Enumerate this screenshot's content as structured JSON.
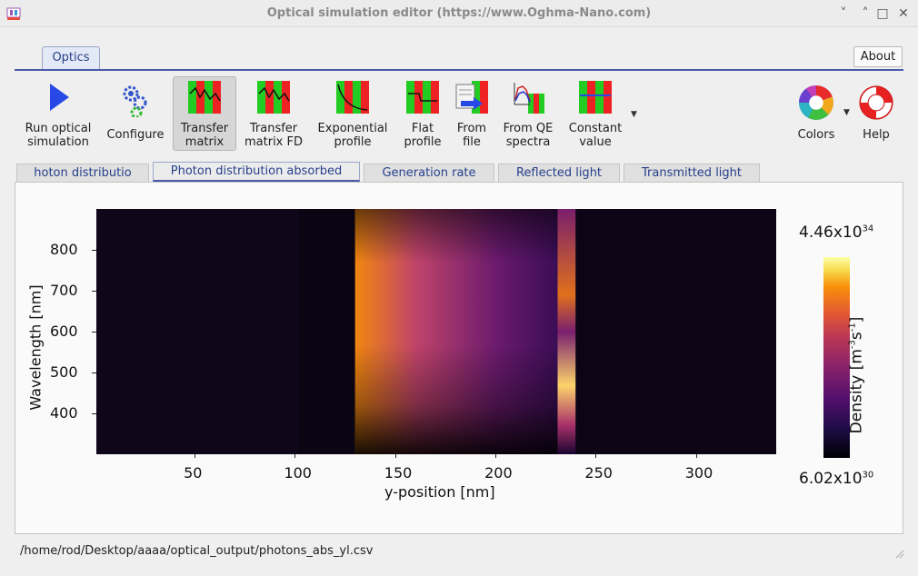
{
  "window": {
    "title": "Optical simulation editor (https://www.Oghma-Nano.com)",
    "controls": [
      "˅",
      "˄",
      "□",
      "✕"
    ]
  },
  "ribbon": {
    "tab": "Optics",
    "about": "About"
  },
  "toolbar": [
    {
      "l1": "Run optical",
      "l2": "simulation"
    },
    {
      "l1": "Configure",
      "l2": ""
    },
    {
      "l1": "Transfer",
      "l2": "matrix"
    },
    {
      "l1": "Transfer",
      "l2": "matrix FD"
    },
    {
      "l1": "Exponential",
      "l2": "profile"
    },
    {
      "l1": "Flat",
      "l2": "profile"
    },
    {
      "l1": "From",
      "l2": "file"
    },
    {
      "l1": "From QE",
      "l2": "spectra"
    },
    {
      "l1": "Constant",
      "l2": "value"
    },
    {
      "l1": "Colors",
      "l2": ""
    },
    {
      "l1": "Help",
      "l2": ""
    }
  ],
  "plot_tabs": [
    "hoton distributio",
    "Photon distribution absorbed",
    "Generation rate",
    "Reflected light",
    "Transmitted light"
  ],
  "icon_names": [
    "run-icon",
    "configure-gears-icon",
    "transfer-matrix-icon",
    "transfer-matrix-fd-icon",
    "exponential-profile-icon",
    "flat-profile-icon",
    "from-file-icon",
    "from-qe-spectra-icon",
    "constant-value-icon",
    "color-wheel-icon",
    "lifebuoy-help-icon"
  ],
  "chart_data": {
    "type": "heatmap",
    "xlabel": "y-position [nm]",
    "ylabel": "Wavelength [nm]",
    "xticks": [
      50,
      100,
      150,
      200,
      250,
      300
    ],
    "yticks": [
      400,
      500,
      600,
      700,
      800
    ],
    "xlim": [
      1,
      340
    ],
    "ylim": [
      300,
      900
    ],
    "colorbar": {
      "label_main": "Density [m",
      "label_sup1": "-3",
      "label_mid": "s",
      "label_sup2": "-1",
      "label_end": "]",
      "max_mant": "4.46x10",
      "max_exp": "34",
      "min_mant": "6.02x10",
      "min_exp": "30",
      "colormap": "inferno"
    },
    "layers": [
      {
        "x_start": 1,
        "x_end": 102,
        "intensity": 0.05
      },
      {
        "x_start": 102,
        "x_end": 130,
        "intensity": 0.01
      },
      {
        "x_start": 130,
        "x_end": 231,
        "intensity": 0.6
      },
      {
        "x_start": 231,
        "x_end": 240,
        "intensity": 0.9
      },
      {
        "x_start": 240,
        "x_end": 340,
        "intensity": 0.03
      }
    ]
  },
  "status": {
    "path": "/home/rod/Desktop/aaaa/optical_output/photons_abs_yl.csv"
  }
}
